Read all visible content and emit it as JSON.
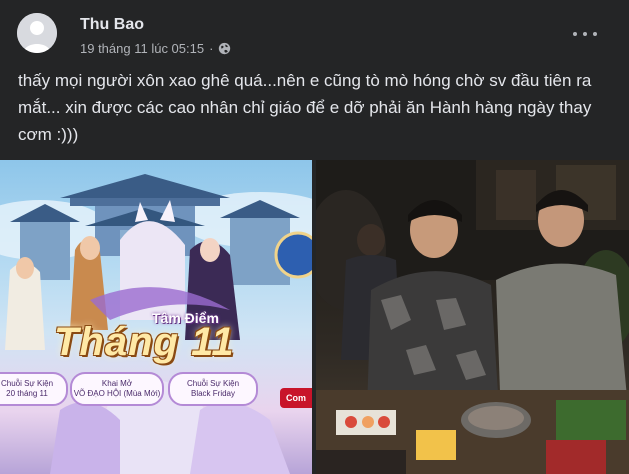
{
  "post": {
    "author": "Thu Bao",
    "timestamp": "19 tháng 11 lúc 05:15",
    "separator": "·",
    "privacy_icon": "globe-icon",
    "more_icon": "more-options-icon",
    "text": "thấy mọi người xôn xao ghê quá...nên e cũng tò mò hóng chờ sv đầu tiên ra mắt... xin được các cao nhân chỉ giáo để e dỡ phải ăn Hành hàng ngày thay cơm :)))"
  },
  "photos": {
    "left": {
      "subtitle": "Tâm Điểm",
      "title": "Tháng 11",
      "events": [
        {
          "line1": "Chuỗi Sự Kiện",
          "line2": "20 tháng 11"
        },
        {
          "line1": "Khai Mở",
          "line2": "VÕ ĐẠO HỘI (Mùa Mới)"
        },
        {
          "line1": "Chuỗi Sự Kiện",
          "line2": "Black Friday"
        }
      ],
      "badge": "Com"
    },
    "right": {}
  },
  "colors": {
    "background": "#242526",
    "text_primary": "#e4e6eb",
    "text_secondary": "#b0b3b8"
  }
}
